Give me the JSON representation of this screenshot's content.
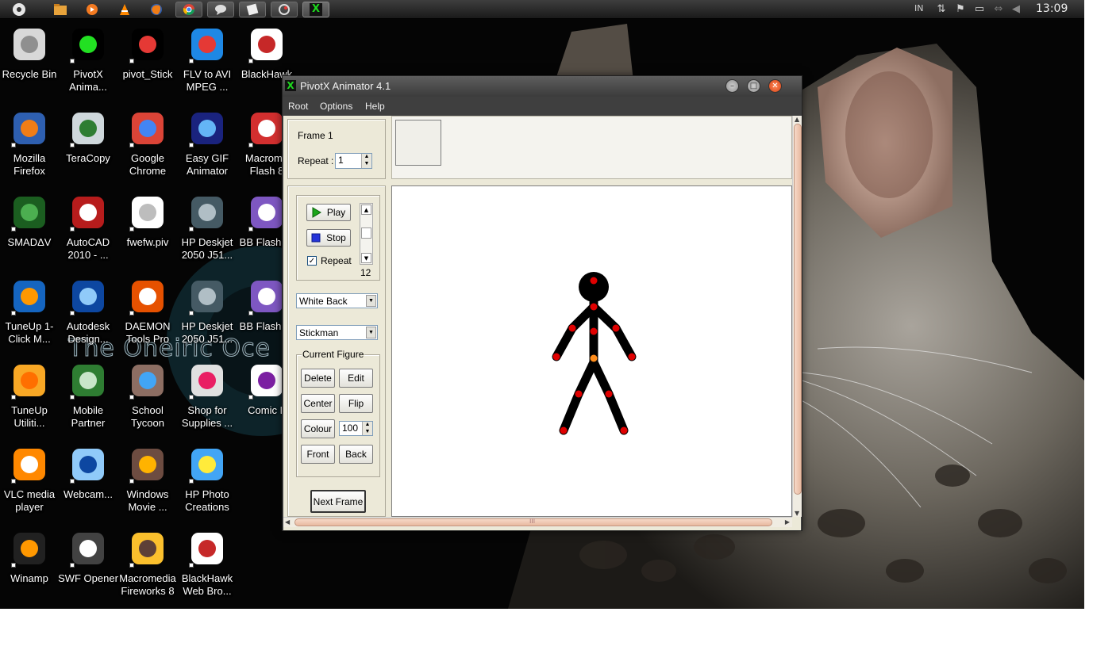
{
  "panel": {
    "language": "IN",
    "clock": "13:09"
  },
  "desktop_icons": [
    {
      "label": "Recycle Bin",
      "icon": "recycle-bin-icon"
    },
    {
      "label": "PivotX Anima...",
      "icon": "pivotx-icon"
    },
    {
      "label": "pivot_Stick",
      "icon": "pivot-stick-icon"
    },
    {
      "label": "FLV to AVI MPEG ...",
      "icon": "flv-converter-icon"
    },
    {
      "label": "BlackHawk",
      "icon": "blackhawk-icon"
    },
    {
      "label": "Mozilla Firefox",
      "icon": "firefox-icon"
    },
    {
      "label": "TeraCopy",
      "icon": "teracopy-icon"
    },
    {
      "label": "Google Chrome",
      "icon": "chrome-icon"
    },
    {
      "label": "Easy GIF Animator",
      "icon": "gif-animator-icon"
    },
    {
      "label": "Macrome Flash 8",
      "icon": "flash-icon"
    },
    {
      "label": "SMADΔV",
      "icon": "smadav-icon"
    },
    {
      "label": "AutoCAD 2010 - ...",
      "icon": "autocad-icon"
    },
    {
      "label": "fwefw.piv",
      "icon": "file-icon"
    },
    {
      "label": "HP Deskjet 2050 J51...",
      "icon": "scanner-icon"
    },
    {
      "label": "BB FlashBa",
      "icon": "bb-flashback-icon"
    },
    {
      "label": "TuneUp 1-Click M...",
      "icon": "tuneup-maintenance-icon"
    },
    {
      "label": "Autodesk Design...",
      "icon": "autodesk-icon"
    },
    {
      "label": "DAEMON Tools Pro",
      "icon": "daemon-tools-icon"
    },
    {
      "label": "HP Deskjet 2050 J51...",
      "icon": "scanner-icon"
    },
    {
      "label": "BB FlashBa",
      "icon": "bb-flashback-icon"
    },
    {
      "label": "TuneUp Utiliti...",
      "icon": "tuneup-utilities-icon"
    },
    {
      "label": "Mobile Partner",
      "icon": "mobile-partner-icon"
    },
    {
      "label": "School Tycoon",
      "icon": "school-tycoon-icon"
    },
    {
      "label": "Shop for Supplies ...",
      "icon": "printer-icon"
    },
    {
      "label": "Comic L",
      "icon": "comic-life-icon"
    },
    {
      "label": "VLC media player",
      "icon": "vlc-icon"
    },
    {
      "label": "Webcam...",
      "icon": "webcam-icon"
    },
    {
      "label": "Windows Movie ...",
      "icon": "movie-maker-icon"
    },
    {
      "label": "HP Photo Creations",
      "icon": "photo-creations-icon"
    },
    {
      "label": "",
      "icon": ""
    },
    {
      "label": "Winamp",
      "icon": "winamp-icon"
    },
    {
      "label": "SWF Opener",
      "icon": "swf-opener-icon"
    },
    {
      "label": "Macromedia Fireworks 8",
      "icon": "fireworks-icon"
    },
    {
      "label": "BlackHawk Web Bro...",
      "icon": "blackhawk-icon"
    }
  ],
  "wallpaper_text": "The Oneiric Oce",
  "app": {
    "title": "PivotX Animator 4.1",
    "menu": [
      "Root",
      "Options",
      "Help"
    ],
    "frame_label": "Frame 1",
    "repeat_label": "Repeat :",
    "repeat_value": "1",
    "play_label": "Play",
    "stop_label": "Stop",
    "repeat_check_label": "Repeat",
    "repeat_checked": true,
    "speed_value": "12",
    "background_select": "White Back",
    "figure_select": "Stickman",
    "current_figure_label": "Current Figure",
    "buttons": {
      "delete": "Delete",
      "edit": "Edit",
      "center": "Center",
      "flip": "Flip",
      "colour": "Colour",
      "front": "Front",
      "back": "Back",
      "next_frame": "Next Frame"
    },
    "colour_value": "100",
    "scroll_grip": "III"
  },
  "colors": {
    "stick_body": "#000000",
    "joint_red": "#e00000",
    "joint_orange": "#ff8c1a",
    "play_green": "#1aa51a",
    "stop_blue": "#2433d8"
  }
}
